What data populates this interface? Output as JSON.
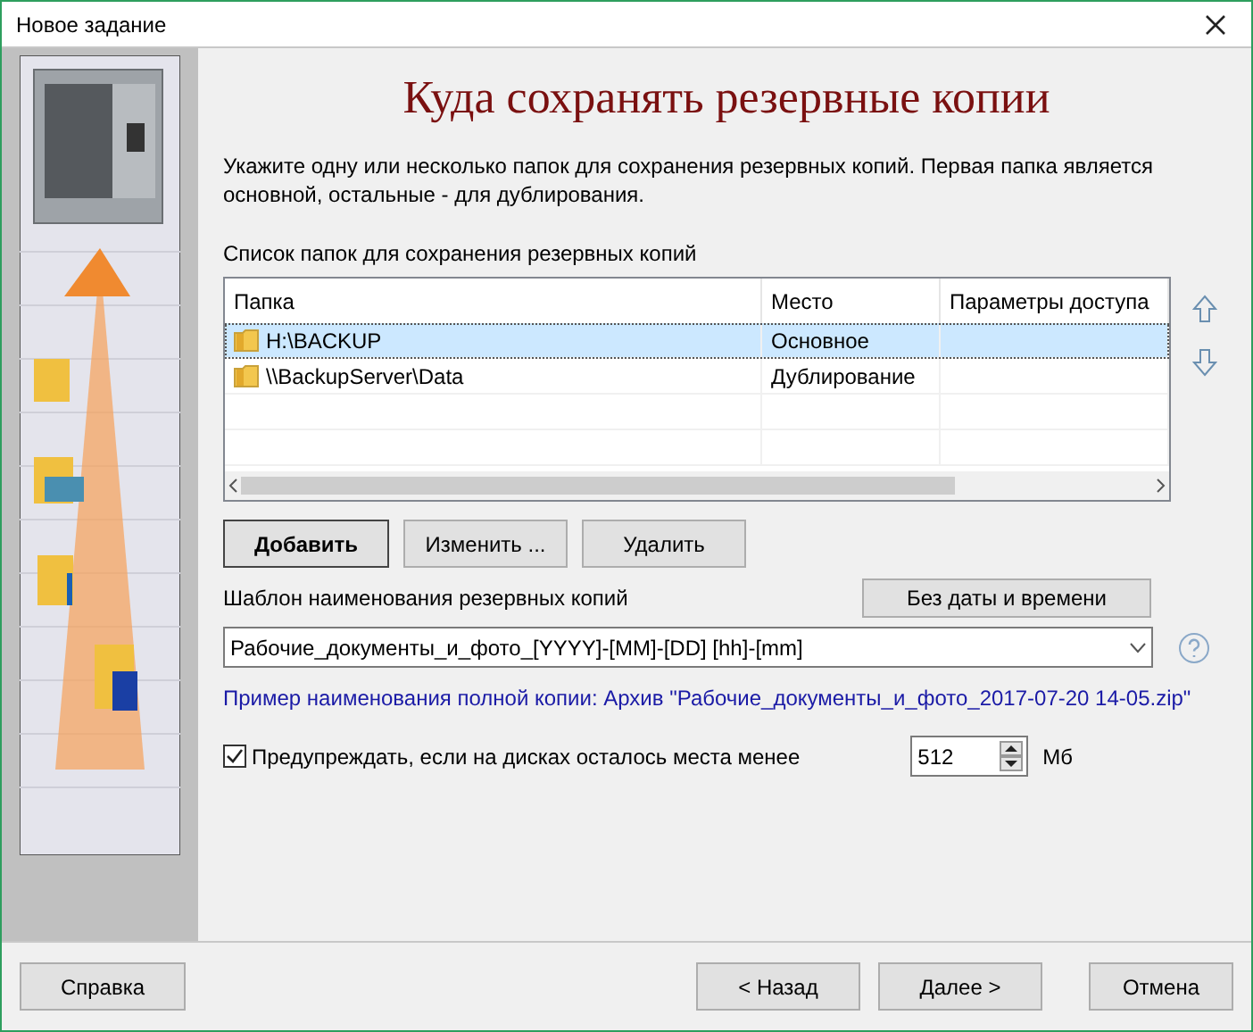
{
  "window": {
    "title": "Новое задание"
  },
  "heading": "Куда сохранять резервные копии",
  "description": "Укажите одну или несколько папок для сохранения резервных копий. Первая папка является основной, остальные - для дублирования.",
  "folders_label": "Список папок для сохранения резервных копий",
  "table": {
    "columns": [
      "Папка",
      "Место",
      "Параметры доступа"
    ],
    "rows": [
      {
        "folder": "H:\\BACKUP",
        "place": "Основное",
        "access": "",
        "selected": true
      },
      {
        "folder": "\\\\BackupServer\\Data",
        "place": "Дублирование",
        "access": "",
        "selected": false
      }
    ]
  },
  "folder_buttons": [
    {
      "label": "Добавить",
      "default": true
    },
    {
      "label": "Изменить ...",
      "default": false
    },
    {
      "label": "Удалить",
      "default": false
    }
  ],
  "template": {
    "label": "Шаблон наименования резервных копий",
    "no_date_button": "Без даты и времени",
    "value": "Рабочие_документы_и_фото_[YYYY]-[MM]-[DD] [hh]-[mm]"
  },
  "example": "Пример наименования полной копии: Архив \"Рабочие_документы_и_фото_2017-07-20 14-05.zip\"",
  "warn": {
    "label": "Предупреждать, если на дисках осталось места менее",
    "checked": true,
    "value": "512",
    "unit": "Мб"
  },
  "footer_buttons": {
    "help": "Справка",
    "back": "< Назад",
    "next": "Далее >",
    "cancel": "Отмена"
  }
}
